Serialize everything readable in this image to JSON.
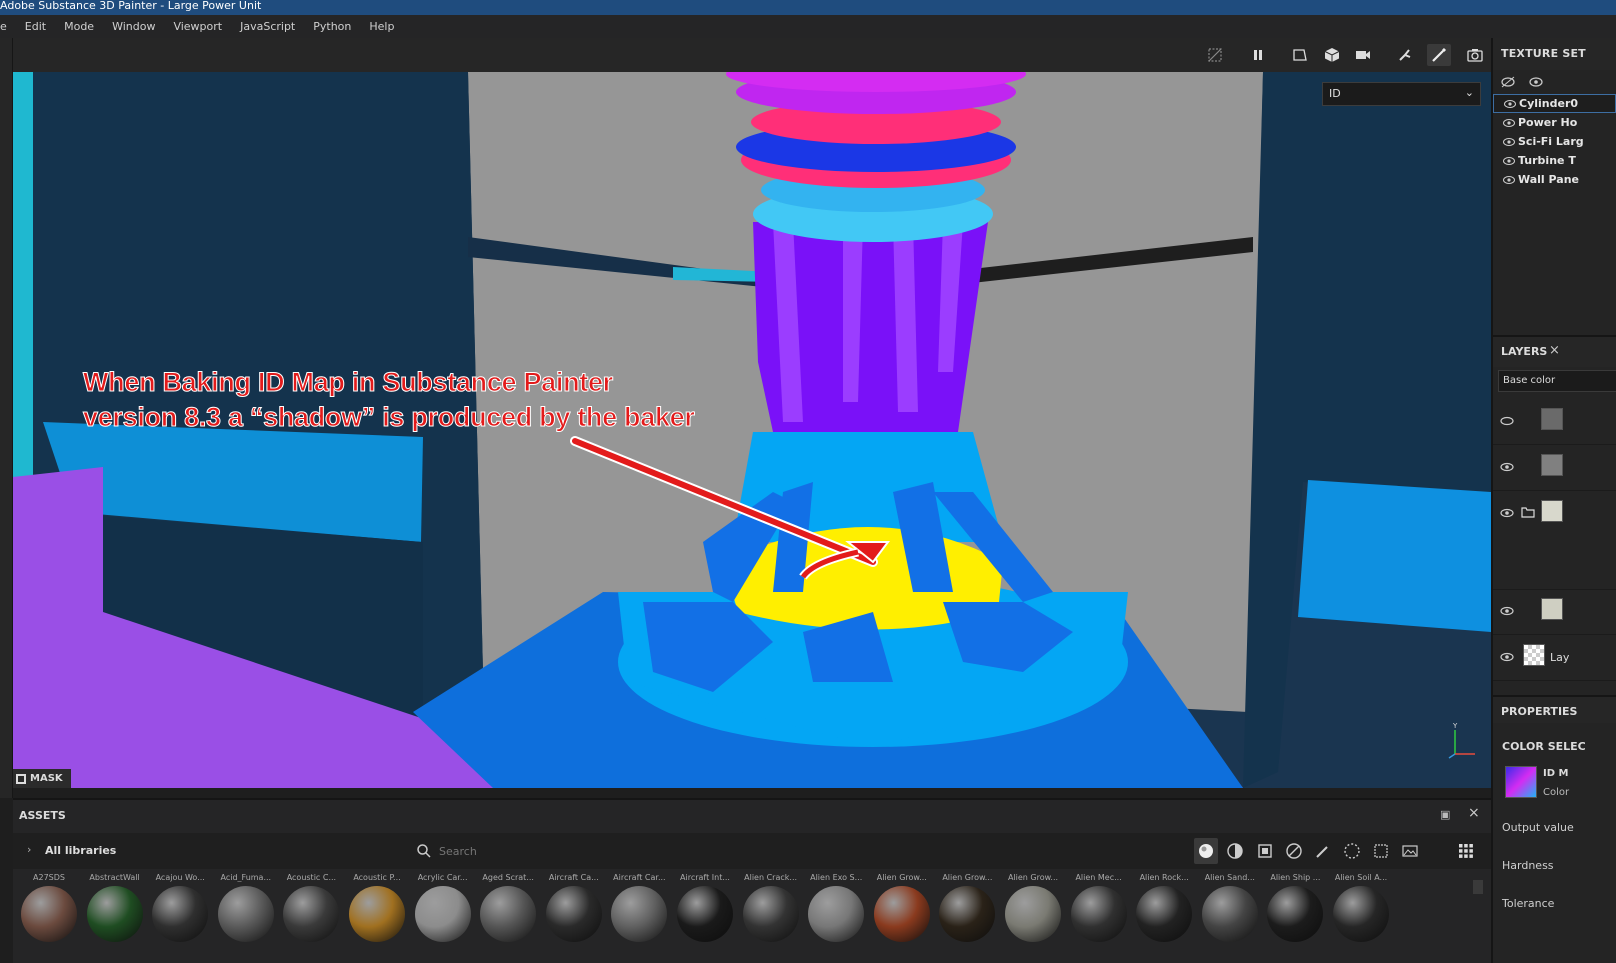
{
  "app": {
    "title": "Adobe Substance 3D Painter - Large Power Unit"
  },
  "menu": [
    {
      "label": "e"
    },
    {
      "label": "Edit"
    },
    {
      "label": "Mode"
    },
    {
      "label": "Window"
    },
    {
      "label": "Viewport"
    },
    {
      "label": "JavaScript"
    },
    {
      "label": "Python"
    },
    {
      "label": "Help"
    }
  ],
  "viewport": {
    "channel_dropdown": "ID",
    "mask_label": "MASK",
    "axis_y_label": "Y",
    "annotation_line1": "When Baking ID Map in Substance Painter",
    "annotation_line2": "version 8.3 a “shadow” is produced by the baker",
    "annotation_color": "#e31b1b"
  },
  "toolbar": {
    "icons": [
      "hide-icon",
      "pause-icon",
      "perspective-icon",
      "cube-icon",
      "camera-icon",
      "tool-icon",
      "brush-icon",
      "screenshot-icon"
    ]
  },
  "texture_sets": {
    "header": "TEXTURE SET",
    "items": [
      {
        "label": "Cylinder0",
        "selected": true
      },
      {
        "label": "Power Ho",
        "selected": false
      },
      {
        "label": "Sci-Fi Larg",
        "selected": false
      },
      {
        "label": "Turbine T",
        "selected": false
      },
      {
        "label": "Wall Pane",
        "selected": false
      }
    ]
  },
  "layers": {
    "header": "LAYERS",
    "channel": "Base color",
    "last_layer_label": "Lay"
  },
  "properties": {
    "header": "PROPERTIES",
    "section": "COLOR SELEC",
    "map_name": "ID M",
    "map_sub": "Color",
    "output_value": "Output value",
    "hardness": "Hardness",
    "tolerance": "Tolerance"
  },
  "assets": {
    "header": "ASSETS",
    "libraries": "All libraries",
    "search_placeholder": "Search",
    "items": [
      {
        "name": "A27SDS",
        "color": "#6b4a3e"
      },
      {
        "name": "AbstractWall",
        "color": "#1f4d22"
      },
      {
        "name": "Acajou Wo...",
        "color": "#2f2f2f"
      },
      {
        "name": "Acid_Fuma...",
        "color": "#5a5a5a"
      },
      {
        "name": "Acoustic C...",
        "color": "#3a3a3a"
      },
      {
        "name": "Acoustic P...",
        "color": "#a07020"
      },
      {
        "name": "Acrylic Car...",
        "color": "#8c8c8c"
      },
      {
        "name": "Aged Scrat...",
        "color": "#555555"
      },
      {
        "name": "Aircraft Ca...",
        "color": "#2a2a2a"
      },
      {
        "name": "Aircraft Car...",
        "color": "#606060"
      },
      {
        "name": "Aircraft Int...",
        "color": "#1a1a1a"
      },
      {
        "name": "Alien Crack...",
        "color": "#333333"
      },
      {
        "name": "Alien Exo S...",
        "color": "#777777"
      },
      {
        "name": "Alien Grow...",
        "color": "#8a3a1e"
      },
      {
        "name": "Alien Grow...",
        "color": "#2a2218"
      },
      {
        "name": "Alien Grow...",
        "color": "#7a7a72"
      },
      {
        "name": "Alien Mec...",
        "color": "#303030"
      },
      {
        "name": "Alien Rock...",
        "color": "#222222"
      },
      {
        "name": "Alien Sand...",
        "color": "#444444"
      },
      {
        "name": "Alien Ship ...",
        "color": "#1c1c1c"
      },
      {
        "name": "Alien Soil A...",
        "color": "#262626"
      }
    ]
  }
}
